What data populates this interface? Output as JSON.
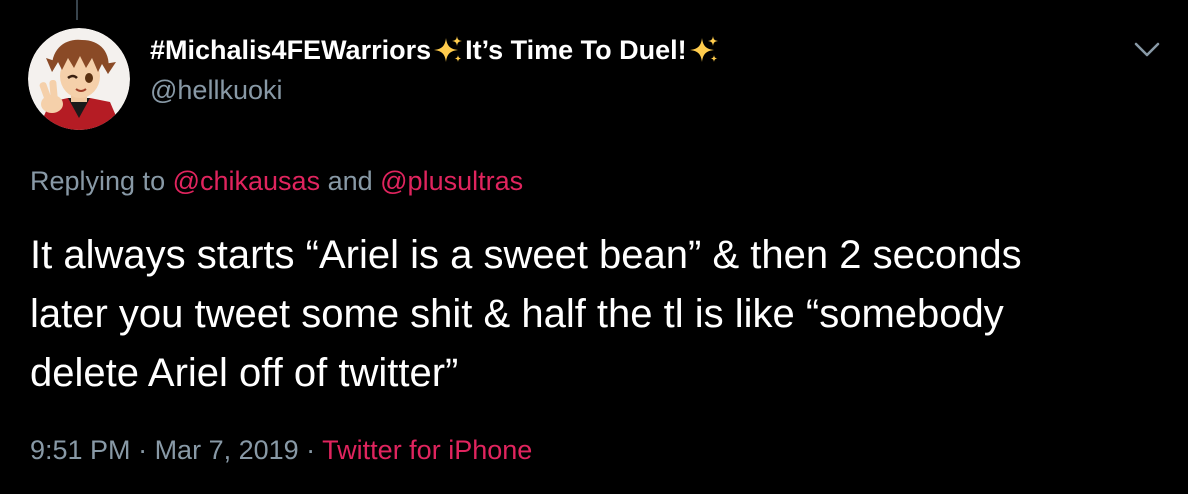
{
  "tweet": {
    "display_name_part1": "#Michalis4FEWarriors",
    "display_name_part2": "It’s Time To Duel!",
    "handle": "@hellkuoki",
    "replying": {
      "prefix": "Replying to ",
      "mention1": "@chikausas",
      "conjunction": " and ",
      "mention2": "@plusultras"
    },
    "text_lines": [
      "It always starts “Ariel is a sweet bean” & then 2 seconds",
      "later you tweet some shit & half the tl is like “somebody",
      "delete Ariel off of twitter”"
    ],
    "time": "9:51 PM",
    "separator": " · ",
    "date": "Mar 7, 2019",
    "source": "Twitter for iPhone"
  },
  "icons": {
    "avatar": "profile-avatar",
    "sparkle": "sparkles-emoji-icon",
    "chevron": "chevron-down-icon"
  },
  "colors": {
    "background": "#000000",
    "text": "#ffffff",
    "secondary": "#8899a6",
    "accent": "#e0245e",
    "sparkle": "#ffcc4d"
  }
}
